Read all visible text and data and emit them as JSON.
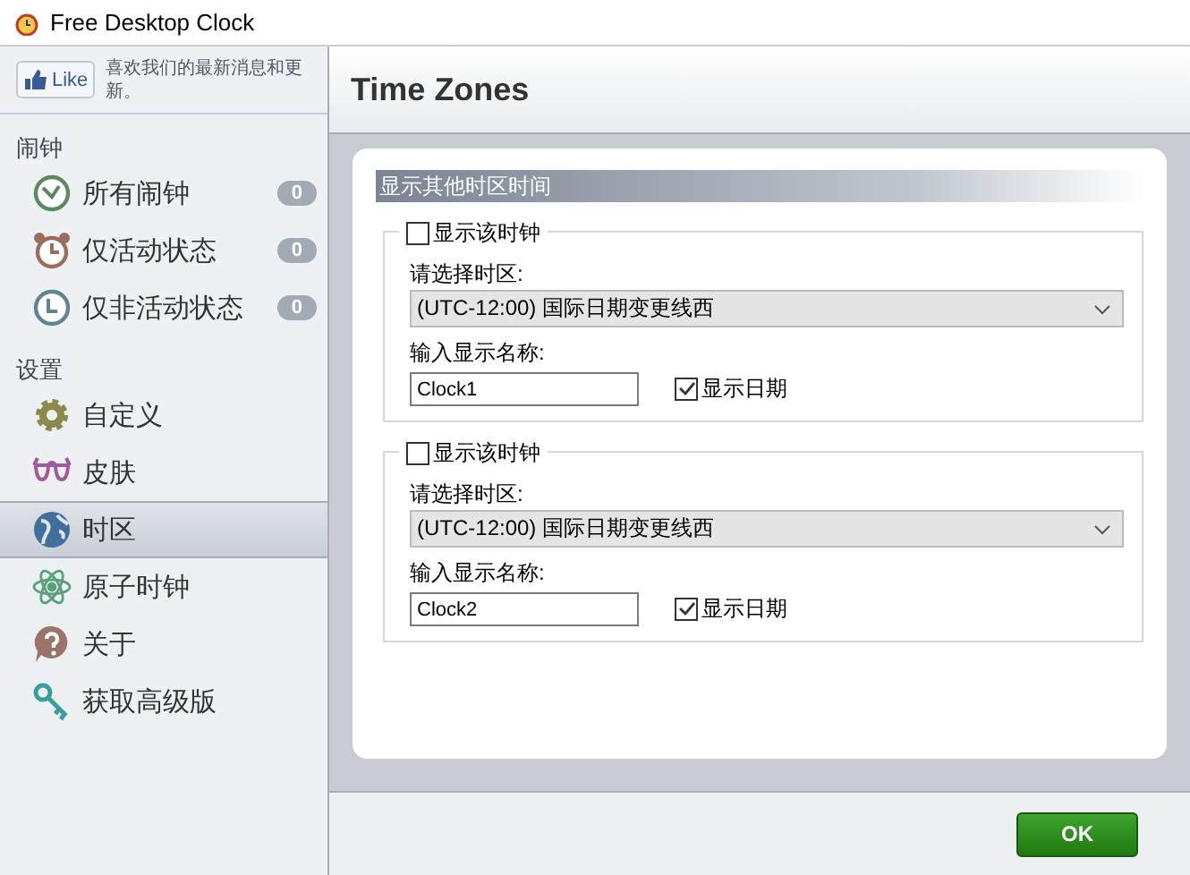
{
  "window": {
    "title": "Free Desktop Clock"
  },
  "like": {
    "button": "Like",
    "text": "喜欢我们的最新消息和更新。"
  },
  "sidebar": {
    "sections": [
      {
        "label": "闹钟",
        "items": [
          {
            "label": "所有闹钟",
            "kind": "clock",
            "badge": "0",
            "selected": false
          },
          {
            "label": "仅活动状态",
            "kind": "alarm",
            "badge": "0",
            "selected": false
          },
          {
            "label": "仅非活动状态",
            "kind": "dial",
            "badge": "0",
            "selected": false
          }
        ]
      },
      {
        "label": "设置",
        "items": [
          {
            "label": "自定义",
            "kind": "gear",
            "selected": false
          },
          {
            "label": "皮肤",
            "kind": "glasses",
            "selected": false
          },
          {
            "label": "时区",
            "kind": "globe",
            "selected": true
          },
          {
            "label": "原子时钟",
            "kind": "atom",
            "selected": false
          },
          {
            "label": "关于",
            "kind": "help",
            "selected": false
          },
          {
            "label": "获取高级版",
            "kind": "key",
            "selected": false
          }
        ]
      }
    ]
  },
  "page": {
    "title": "Time Zones",
    "group_title": "显示其他时区时间",
    "clocks": [
      {
        "show_label": "显示该时钟",
        "show_checked": false,
        "tz_label": "请选择时区:",
        "tz_value": "(UTC-12:00) 国际日期变更线西",
        "name_label": "输入显示名称:",
        "name_value": "Clock1",
        "date_label": "显示日期",
        "date_checked": true
      },
      {
        "show_label": "显示该时钟",
        "show_checked": false,
        "tz_label": "请选择时区:",
        "tz_value": "(UTC-12:00) 国际日期变更线西",
        "name_label": "输入显示名称:",
        "name_value": "Clock2",
        "date_label": "显示日期",
        "date_checked": true
      }
    ]
  },
  "buttons": {
    "ok": "OK"
  }
}
